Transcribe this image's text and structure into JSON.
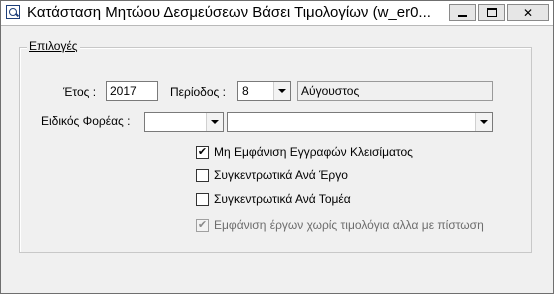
{
  "window": {
    "title": "Κατάσταση Μητώου Δεσμεύσεων Βάσει Τιμολογίων   (w_er0...",
    "minimize_glyph": "minimize-icon",
    "maximize_glyph": "maximize-icon",
    "close_label": "✕"
  },
  "group": {
    "label": "Επιλογές"
  },
  "form": {
    "year_label": "Έτος :",
    "year_value": "2017",
    "period_label": "Περίοδος :",
    "period_value": "8",
    "period_name": "Αύγουστος",
    "body_label": "Ειδικός Φορέας :",
    "body_code": "",
    "body_name": ""
  },
  "options": [
    {
      "label": "Μη Εμφάνιση Εγγραφών Κλεισίματος",
      "checked": true,
      "enabled": true
    },
    {
      "label": "Συγκεντρωτικά Ανά Έργο",
      "checked": false,
      "enabled": true
    },
    {
      "label": "Συγκεντρωτικά Ανά Τομέα",
      "checked": false,
      "enabled": true
    },
    {
      "label": "Εμφάνιση έργων χωρίς τιμολόγια αλλα με πίστωση",
      "checked": true,
      "enabled": false
    }
  ]
}
